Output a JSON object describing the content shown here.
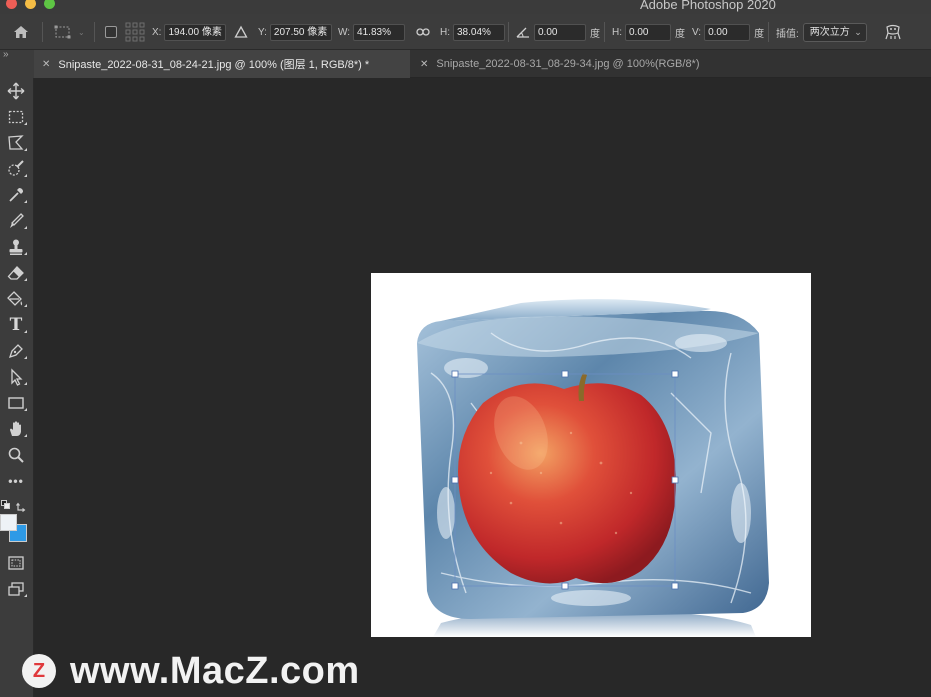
{
  "app": {
    "title": "Adobe Photoshop 2020"
  },
  "window": {
    "controls": [
      {
        "name": "close-window-button",
        "color": "#ee5e56"
      },
      {
        "name": "minimize-window-button",
        "color": "#f5bd45"
      },
      {
        "name": "zoom-window-button",
        "color": "#5ec544"
      }
    ]
  },
  "options_bar": {
    "home_icon": "home-icon",
    "transform_icon": "transform-selection-icon",
    "reference_point_icon": "reference-point-grid-icon",
    "x_label": "X:",
    "x_value": "194.00 像素",
    "delta_icon": "relative-position-icon",
    "y_label": "Y:",
    "y_value": "207.50 像素",
    "w_label": "W:",
    "w_value": "41.83%",
    "link_icon": "link-icon",
    "h_label": "H:",
    "h_value": "38.04%",
    "angle_icon": "rotate-angle-icon",
    "angle_value": "0.00",
    "angle_unit": "度",
    "skew_h_label": "H:",
    "skew_h_value": "0.00",
    "skew_h_unit": "度",
    "skew_v_label": "V:",
    "skew_v_value": "0.00",
    "skew_v_unit": "度",
    "interpolation_label": "插值:",
    "interpolation_value": "两次立方",
    "warp_icon": "warp-mode-icon"
  },
  "panel_toggle": {
    "label": "»"
  },
  "tabs": [
    {
      "label": "Snipaste_2022-08-31_08-24-21.jpg @ 100% (图层 1, RGB/8*) *",
      "active": true
    },
    {
      "label": "Snipaste_2022-08-31_08-29-34.jpg @ 100%(RGB/8*)",
      "active": false
    }
  ],
  "tools": [
    {
      "name": "move-tool",
      "icon": "move-icon"
    },
    {
      "name": "marquee-tool",
      "icon": "rectangle-marquee-icon"
    },
    {
      "name": "lasso-tool",
      "icon": "polygon-lasso-icon"
    },
    {
      "name": "quick-selection-tool",
      "icon": "quick-selection-icon"
    },
    {
      "name": "eyedropper-tool",
      "icon": "eyedropper-icon"
    },
    {
      "name": "brush-tool",
      "icon": "brush-icon"
    },
    {
      "name": "stamp-tool",
      "icon": "clone-stamp-icon"
    },
    {
      "name": "eraser-tool",
      "icon": "eraser-icon"
    },
    {
      "name": "paint-bucket-tool",
      "icon": "paint-bucket-icon"
    },
    {
      "name": "type-tool",
      "icon": "type-icon",
      "label": "T"
    },
    {
      "name": "pen-tool",
      "icon": "pen-icon"
    },
    {
      "name": "path-selection-tool",
      "icon": "arrow-select-icon"
    },
    {
      "name": "rectangle-tool",
      "icon": "rectangle-shape-icon"
    },
    {
      "name": "hand-tool",
      "icon": "hand-icon"
    },
    {
      "name": "zoom-tool",
      "icon": "zoom-icon"
    },
    {
      "name": "more-tools",
      "icon": "more-icon",
      "label": "•••"
    }
  ],
  "colors": {
    "foreground": "#eef2f6",
    "background": "#2e9ae6"
  },
  "watermark": {
    "logo_letter": "Z",
    "text": "www.MacZ.com"
  }
}
